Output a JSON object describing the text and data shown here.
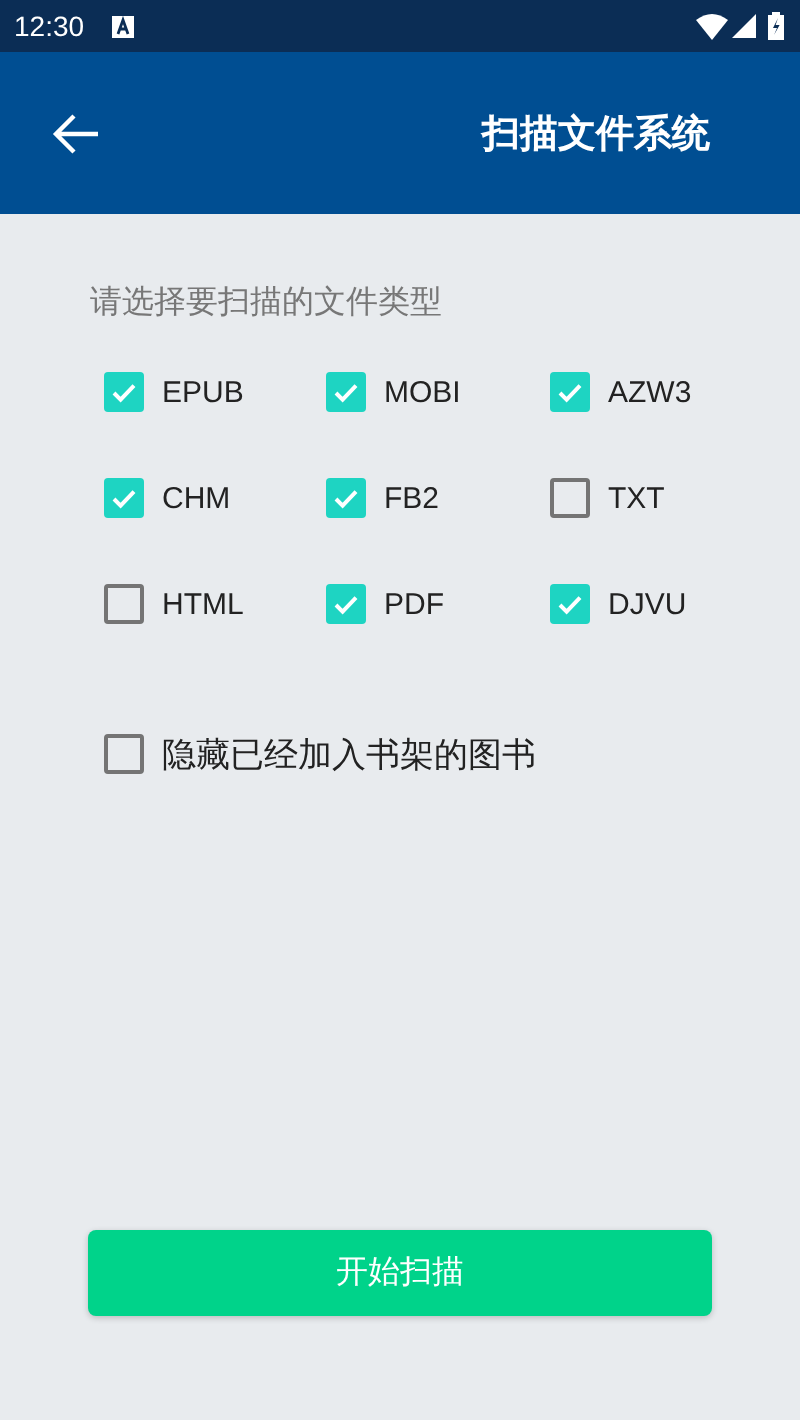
{
  "status_bar": {
    "time": "12:30"
  },
  "app_bar": {
    "title": "扫描文件系统"
  },
  "prompt": "请选择要扫描的文件类型",
  "file_types": [
    {
      "label": "EPUB",
      "checked": true
    },
    {
      "label": "MOBI",
      "checked": true
    },
    {
      "label": "AZW3",
      "checked": true
    },
    {
      "label": "CHM",
      "checked": true
    },
    {
      "label": "FB2",
      "checked": true
    },
    {
      "label": "TXT",
      "checked": false
    },
    {
      "label": "HTML",
      "checked": false
    },
    {
      "label": "PDF",
      "checked": true
    },
    {
      "label": "DJVU",
      "checked": true
    }
  ],
  "hide_option": {
    "label": "隐藏已经加入书架的图书",
    "checked": false
  },
  "start_button": "开始扫描"
}
